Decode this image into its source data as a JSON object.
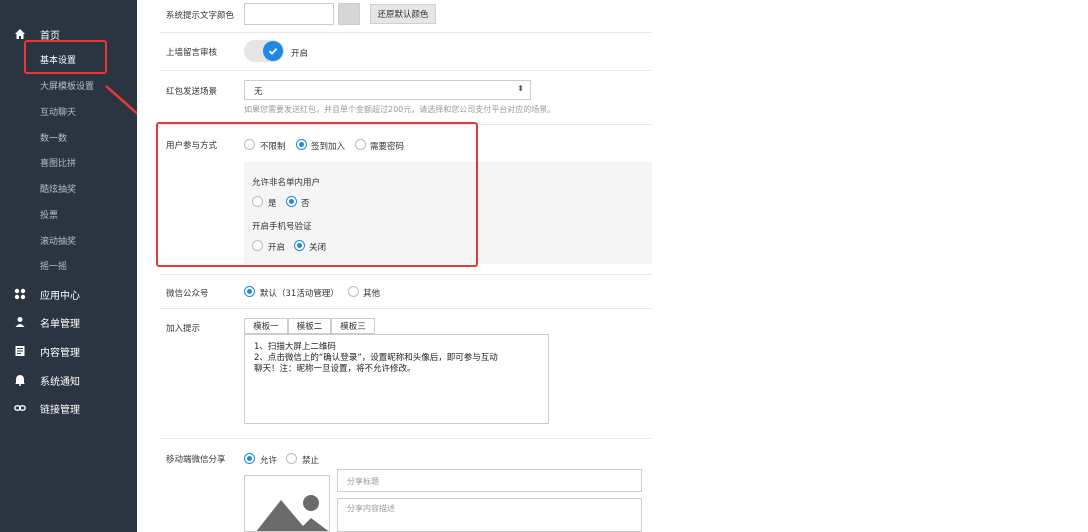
{
  "sidebar": {
    "home": "首页",
    "sub_items": [
      "基本设置",
      "大屏模板设置",
      "互动聊天",
      "数一数",
      "喜图比拼",
      "酷炫抽奖",
      "投票",
      "滚动抽奖",
      "摇一摇"
    ],
    "main_items": [
      {
        "label": "应用中心",
        "icon": "apps-icon"
      },
      {
        "label": "名单管理",
        "icon": "user-icon"
      },
      {
        "label": "内容管理",
        "icon": "document-icon"
      },
      {
        "label": "系统通知",
        "icon": "bell-icon"
      },
      {
        "label": "链接管理",
        "icon": "link-icon"
      }
    ]
  },
  "settings": {
    "text_color": {
      "label": "系统提示文字颜色",
      "reset_label": "还原默认颜色"
    },
    "wall_review": {
      "label": "上墙留言审核",
      "state_label": "开启"
    },
    "red_packet": {
      "label": "红包发送场景",
      "value": "无",
      "hint": "如果您需要发送红包，并且单个金额超过200元，请选择和您公司支付平台对应的场景。"
    },
    "participation": {
      "label": "用户参与方式",
      "options": [
        "不限制",
        "签到加入",
        "需要密码"
      ],
      "allow_non_list_label": "允许非名单内用户",
      "allow_options": [
        "是",
        "否"
      ],
      "phone_verify_label": "开启手机号验证",
      "phone_options": [
        "开启",
        "关闭"
      ]
    },
    "wechat_account": {
      "label": "微信公众号",
      "options": [
        "默认（31活动管理）",
        "其他"
      ]
    },
    "join_tip": {
      "label": "加入提示",
      "tabs": [
        "模板一",
        "模板二",
        "模板三"
      ],
      "text": "1、扫描大屏上二维码\n2、点击微信上的“确认登录”，设置昵称和头像后，即可参与互动\n聊天！注：昵称一旦设置，将不允许修改。"
    },
    "mobile_share": {
      "label": "移动端微信分享",
      "options": [
        "允许",
        "禁止"
      ],
      "title_placeholder": "分享标题",
      "desc_placeholder": "分享内容描述"
    }
  },
  "colors": {
    "sidebar_bg": "#2b3441",
    "accent": "#1e88e5",
    "highlight": "#e53935"
  }
}
